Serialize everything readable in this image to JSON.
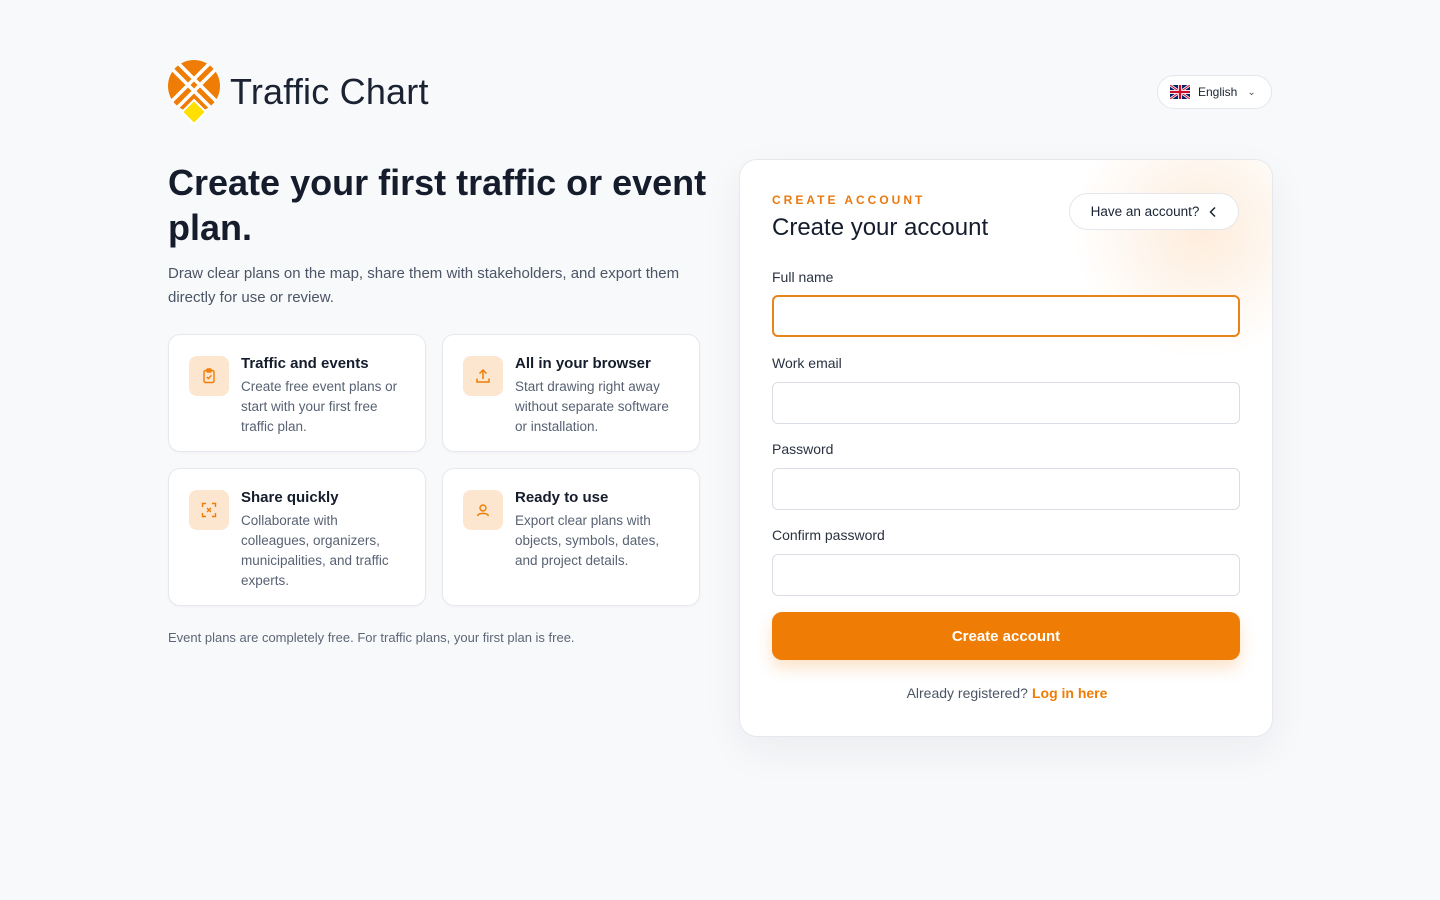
{
  "brand": {
    "name": "Traffic Chart",
    "primary_color": "#ef7d05",
    "accent_yellow": "#ffe000"
  },
  "language": {
    "label": "English",
    "flag_icon": "uk-flag-icon"
  },
  "hero": {
    "headline": "Create your first traffic or event plan.",
    "subtitle": "Draw clear plans on the map, share them with stakeholders, and export them directly for use or review."
  },
  "features": [
    {
      "icon": "clipboard-check-icon",
      "title": "Traffic and events",
      "desc": "Create free event plans or start with your first free traffic plan."
    },
    {
      "icon": "upload-icon",
      "title": "All in your browser",
      "desc": "Start drawing right away without separate software or installation."
    },
    {
      "icon": "share-scan-icon",
      "title": "Share quickly",
      "desc": "Collaborate with colleagues, organizers, municipalities, and traffic experts."
    },
    {
      "icon": "user-icon",
      "title": "Ready to use",
      "desc": "Export clear plans with objects, symbols, dates, and project details."
    }
  ],
  "footnote": "Event plans are completely free. For traffic plans, your first plan is free.",
  "form": {
    "eyebrow": "CREATE ACCOUNT",
    "title": "Create your account",
    "have_account": "Have an account?",
    "fields": [
      {
        "label": "Full name",
        "value": ""
      },
      {
        "label": "Work email",
        "value": ""
      },
      {
        "label": "Password",
        "value": ""
      },
      {
        "label": "Confirm password",
        "value": ""
      }
    ],
    "submit": "Create account",
    "login_prompt": "Already registered?",
    "login_link": "Log in here"
  }
}
